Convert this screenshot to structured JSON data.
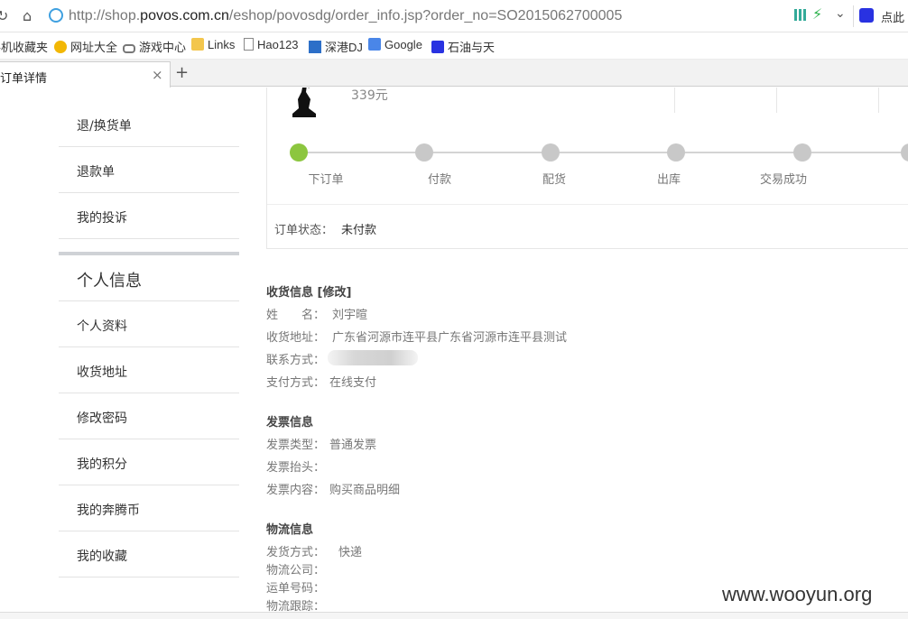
{
  "browser": {
    "url_prefix": "http://shop.",
    "url_domain": "povos.com.cn",
    "url_path": "/eshop/povosdg/order_info.jsp?order_no=SO2015062700005",
    "search_hint": "点此",
    "bookmarks": [
      {
        "label": "手机收藏夹",
        "icon": "none"
      },
      {
        "label": "网址大全",
        "icon": "nav-icon"
      },
      {
        "label": "游戏中心",
        "icon": "gamepad-icon"
      },
      {
        "label": "Links",
        "icon": "folder-icon"
      },
      {
        "label": "Hao123",
        "icon": "page-icon"
      },
      {
        "label": "深港DJ",
        "icon": "dj-icon"
      },
      {
        "label": "Google",
        "icon": "google-icon"
      },
      {
        "label": "石油与天",
        "icon": "baidu-icon"
      }
    ],
    "tab_title": "订单详情",
    "tab_close": "×",
    "new_tab": "+"
  },
  "sidebar": {
    "items_top": [
      "退/换货单",
      "退款单",
      "我的投诉"
    ],
    "section_title": "个人信息",
    "items_bottom": [
      "个人资料",
      "收货地址",
      "修改密码",
      "我的积分",
      "我的奔腾币",
      "我的收藏"
    ]
  },
  "order": {
    "price": "339元",
    "steps": [
      "下订单",
      "付款",
      "配货",
      "出库",
      "交易成功"
    ],
    "current_step": 1,
    "status_label": "订单状态：",
    "status_value": "未付款"
  },
  "shipping": {
    "title": "收货信息 [修改]",
    "name_label": "姓　　名：",
    "name_value": "刘宇暄",
    "address_label": "收货地址：",
    "address_value": "广东省河源市连平县广东省河源市连平县测试",
    "phone_label": "联系方式：",
    "pay_label": "支付方式：",
    "pay_value": "在线支付"
  },
  "invoice": {
    "title": "发票信息",
    "type_label": "发票类型：",
    "type_value": "普通发票",
    "header_label": "发票抬头：",
    "content_label": "发票内容：",
    "content_value": "购买商品明细"
  },
  "logistics": {
    "title": "物流信息",
    "method_label": "发货方式：",
    "method_value": "快递",
    "company_label": "物流公司：",
    "number_label": "运单号码：",
    "tracking_label": "物流跟踪："
  },
  "watermark": "www.wooyun.org",
  "colors": {
    "step_done": "#8cc63f",
    "step_pending": "#c8c8c8"
  }
}
